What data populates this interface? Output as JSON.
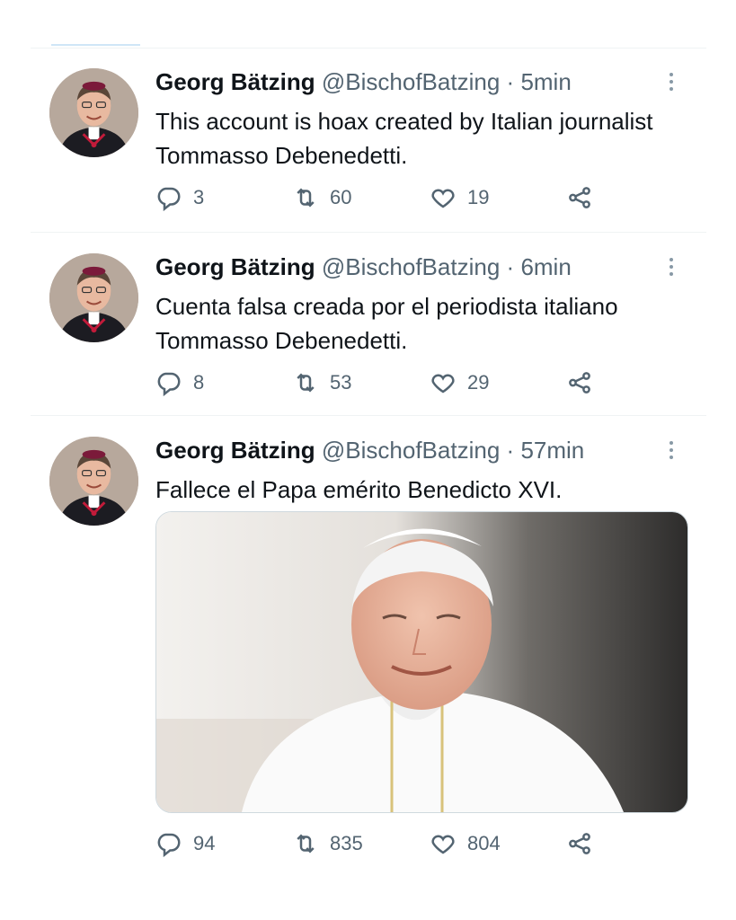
{
  "tweets": [
    {
      "author": {
        "name": "Georg Bätzing",
        "handle": "@BischofBatzing"
      },
      "separator": "·",
      "time": "5min",
      "text": "This account is hoax created by Italian journalist Tommasso Debenedetti.",
      "stats": {
        "replies": "3",
        "retweets": "60",
        "likes": "19"
      }
    },
    {
      "author": {
        "name": "Georg Bätzing",
        "handle": "@BischofBatzing"
      },
      "separator": "·",
      "time": "6min",
      "text": "Cuenta falsa creada por el periodista italiano Tommasso Debenedetti.",
      "stats": {
        "replies": "8",
        "retweets": "53",
        "likes": "29"
      }
    },
    {
      "author": {
        "name": "Georg Bätzing",
        "handle": "@BischofBatzing"
      },
      "separator": "·",
      "time": "57min",
      "text": "Fallece el Papa emérito Benedicto XVI.",
      "stats": {
        "replies": "94",
        "retweets": "835",
        "likes": "804"
      }
    }
  ],
  "icons": {
    "reply": "reply-icon",
    "retweet": "retweet-icon",
    "like": "heart-icon",
    "share": "share-icon",
    "more": "more-options-icon"
  },
  "colors": {
    "secondary_text": "#536471",
    "primary_text": "#0f1419",
    "divider": "#eff3f4"
  }
}
